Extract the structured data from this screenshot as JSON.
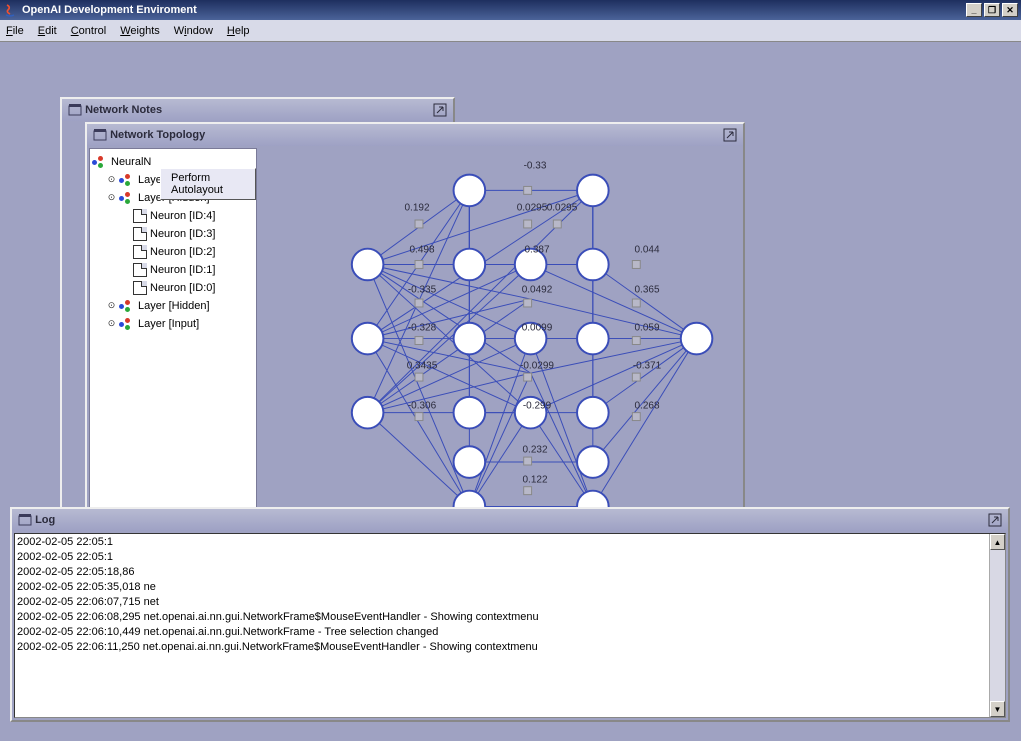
{
  "app": {
    "title": "OpenAI Development Enviroment",
    "menus": [
      "File",
      "Edit",
      "Control",
      "Weights",
      "Window",
      "Help"
    ]
  },
  "notes_window": {
    "title": "Network Notes"
  },
  "topology_window": {
    "title": "Network Topology",
    "context_menu": "Perform Autolayout",
    "tree": {
      "root": "NeuralN",
      "layer_output": "Layer [Output]",
      "layer_hidden1": "Layer [Hidden]",
      "neurons": [
        "Neuron [ID:4]",
        "Neuron [ID:3]",
        "Neuron [ID:2]",
        "Neuron [ID:1]",
        "Neuron [ID:0]"
      ],
      "layer_hidden2": "Layer [Hidden]",
      "layer_input": "Layer [Input]"
    },
    "weights_right": [
      "0.044",
      "0.365",
      "0.059",
      "-0.371",
      "0.268"
    ],
    "weights_top": "-0.33",
    "weights_upper": [
      "0.192",
      "0.0295",
      "0.0295"
    ],
    "weights_r1": [
      "0.498",
      "0.387"
    ],
    "weights_r2": [
      "-0.335",
      "0.0492"
    ],
    "weights_r3": [
      "-0.328",
      "0.0099"
    ],
    "weights_r4": [
      "0.3435",
      "-0.0299"
    ],
    "weights_lower": [
      "-0.306",
      "-0.299"
    ],
    "weights_b1": "0.232",
    "weights_b2": "0.122"
  },
  "log_window": {
    "title": "Log",
    "lines": [
      "2002-02-05 22:05:1",
      "2002-02-05 22:05:1",
      "2002-02-05 22:05:18,86",
      "2002-02-05 22:05:35,018 ne",
      "2002-02-05 22:06:07,715 net",
      "2002-02-05 22:06:08,295 net.openai.ai.nn.gui.NetworkFrame$MouseEventHandler - Showing contextmenu",
      "2002-02-05 22:06:10,449 net.openai.ai.nn.gui.NetworkFrame - Tree selection changed",
      "2002-02-05 22:06:11,250 net.openai.ai.nn.gui.NetworkFrame$MouseEventHandler - Showing contextmenu"
    ],
    "obscured_suffix": "enu"
  }
}
